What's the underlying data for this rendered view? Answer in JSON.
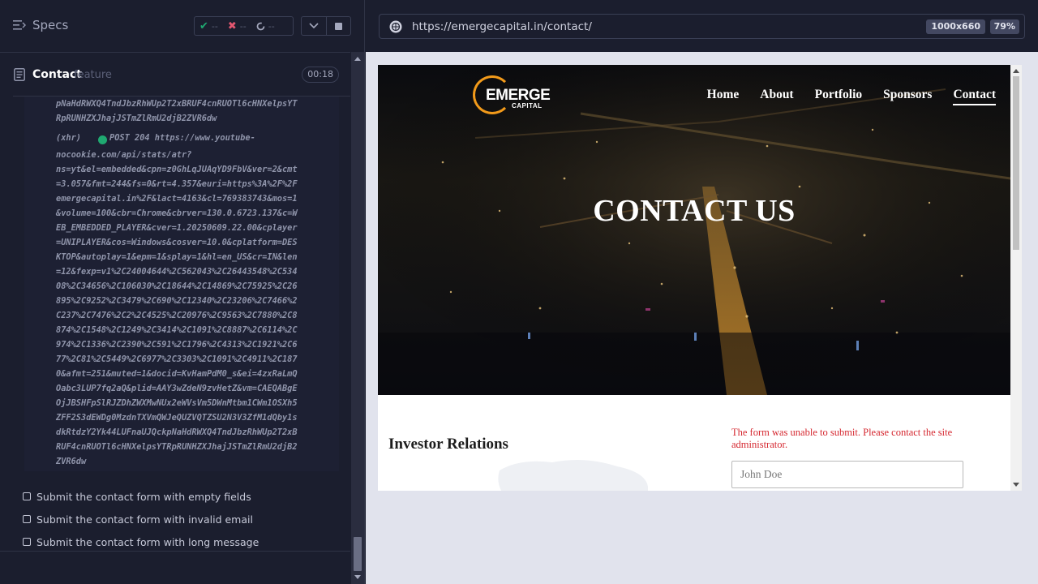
{
  "reporter": {
    "specs_label": "Specs",
    "stats": {
      "passed": "--",
      "failed": "--",
      "pending": "--"
    },
    "runnable": {
      "title": "Contact",
      "kind": "feature",
      "timer": "00:18"
    },
    "log_tail": "pNaHdRWXQ4TndJbzRhWUp2T2xBRUF4cnRUOTl6cHNXelpsYT\nRpRUNHZXJhajJSTmZlRmU2djB2ZVR6dw",
    "xhr": {
      "label": "(xhr)",
      "method_status": "POST 204",
      "first_line": "POST 204 https://www.youtube-",
      "body": "nocookie.com/api/stats/atr?\nns=yt&el=embedded&cpn=z0GhLqJUAqYD9FbV&ver=2&cmt\n=3.057&fmt=244&fs=0&rt=4.357&euri=https%3A%2F%2F\nemergecapital.in%2F&lact=4163&cl=769383743&mos=1\n&volume=100&cbr=Chrome&cbrver=130.0.6723.137&c=W\nEB_EMBEDDED_PLAYER&cver=1.20250609.22.00&cplayer\n=UNIPLAYER&cos=Windows&cosver=10.0&cplatform=DES\nKTOP&autoplay=1&epm=1&splay=1&hl=en_US&cr=IN&len\n=12&fexp=v1%2C24004644%2C562043%2C26443548%2C534\n08%2C34656%2C106030%2C18644%2C14869%2C75925%2C26\n895%2C9252%2C3479%2C690%2C12340%2C23206%2C7466%2\nC237%2C7476%2C2%2C4525%2C20976%2C9563%2C7880%2C8\n874%2C1548%2C1249%2C3414%2C1091%2C8887%2C6114%2C\n974%2C1336%2C2390%2C591%2C1796%2C4313%2C1921%2C6\n77%2C81%2C5449%2C6977%2C3303%2C1091%2C4911%2C187\n0&afmt=251&muted=1&docid=KvHamPdM0_s&ei=4zxRaLmQ\nOabc3LUP7fq2aQ&plid=AAY3wZdeN9zvHetZ&vm=CAEQABgE\nOjJBSHFpSlRJZDhZWXMwNUx2eWVsVm5DWnMtbm1CWm1OSXh5\nZFF2S3dEWDg0MzdnTXVmQWJeQUZVQTZSU2N3V3ZfM1dQby1s\ndkRtdzY2Yk44LUFnaUJQckpNaHdRWXQ4TndJbzRhWUp2T2xB\nRUF4cnRUOTl6cHNXelpsYTRpRUNHZXJhajJSTmZlRmU2djB2\nZVR6dw"
    },
    "tests": [
      "Submit the contact form with empty fields",
      "Submit the contact form with invalid email",
      "Submit the contact form with long message"
    ]
  },
  "aut": {
    "url": "https://emergecapital.in/contact/",
    "viewport": "1000x660",
    "zoom": "79%"
  },
  "site": {
    "logo_main": "EMERGE",
    "logo_sub": "CAPITAL",
    "nav": [
      "Home",
      "About",
      "Portfolio",
      "Sponsors",
      "Contact"
    ],
    "hero_title": "CONTACT US",
    "section_title": "Investor Relations",
    "form_error": "The form was unable to submit. Please contact the site administrator.",
    "name_placeholder": "John Doe"
  },
  "colors": {
    "passed": "#1fa971",
    "failed": "#e45770",
    "accent_logo": "#f29a1a",
    "error": "#d5272f"
  }
}
